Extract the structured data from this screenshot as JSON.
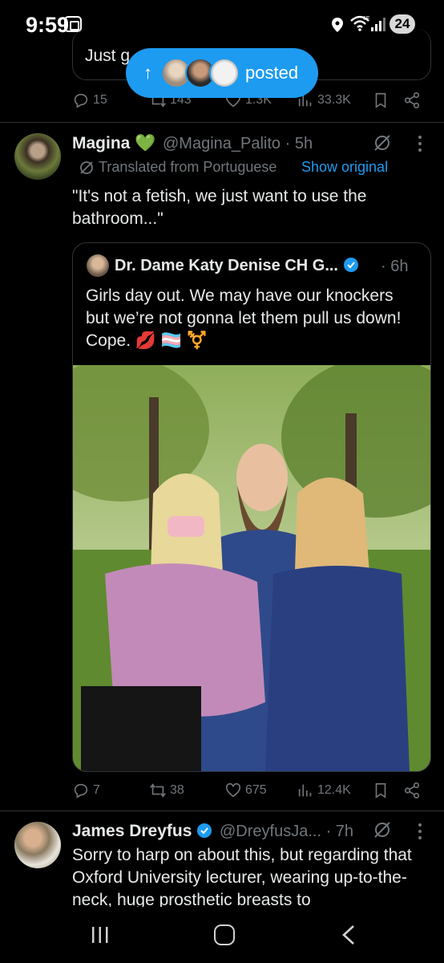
{
  "status_bar": {
    "time": "9:59",
    "network": "6E",
    "battery": "24"
  },
  "prev_tweet": {
    "text": "Just g",
    "stats": {
      "replies": "15",
      "reposts": "143",
      "likes": "1.3K",
      "views": "33.3K"
    }
  },
  "posted_pill": {
    "label": "posted"
  },
  "tweet": {
    "author": "Magina",
    "emoji": "💚",
    "handle": "@Magina_Palito",
    "time": "· 5h",
    "translated": "Translated from Portuguese",
    "show_original": "Show original",
    "text": "\"It's not a fetish, we just want to use the bathroom...\"",
    "quote": {
      "author": "Dr. Dame Katy Denise CH G...",
      "time": "· 6h",
      "text": "Girls day out. We may have our knockers but we’re not gonna let them pull us down! Cope. 💋 🏳️‍⚧️ ⚧️"
    },
    "stats": {
      "replies": "7",
      "reposts": "38",
      "likes": "675",
      "views": "12.4K"
    }
  },
  "tweet2": {
    "author": "James Dreyfus",
    "handle": "@DreyfusJa...",
    "time": "· 7h",
    "text": "Sorry to harp on about this, but regarding that Oxford University lecturer, wearing up-to-the-neck, huge prosthetic breasts to"
  },
  "colors": {
    "accent": "#1d9bf0",
    "bg": "#000000",
    "text": "#e7e9ea",
    "muted": "#71767b",
    "border": "#2f3336"
  }
}
